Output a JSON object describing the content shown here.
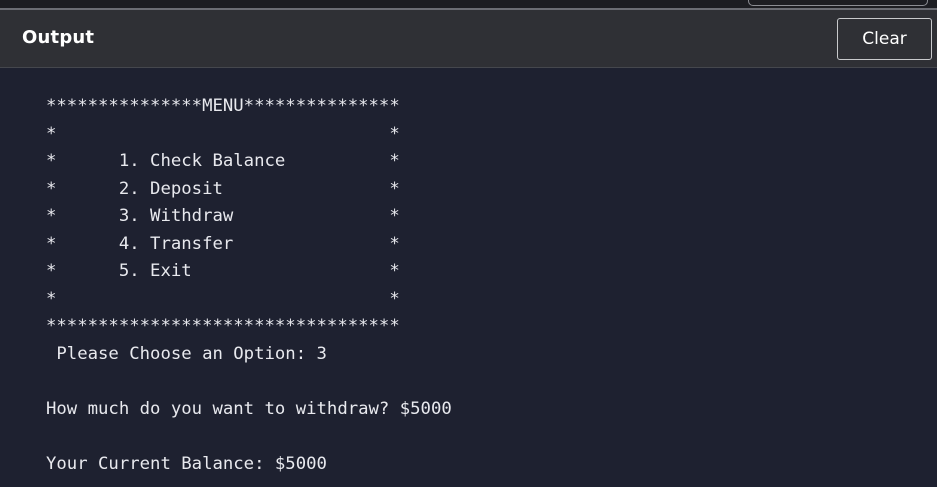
{
  "header": {
    "title": "Output",
    "clear_label": "Clear"
  },
  "console": {
    "lines": [
      "***************MENU***************",
      "*                                *",
      "*      1. Check Balance          *",
      "*      2. Deposit                *",
      "*      3. Withdraw               *",
      "*      4. Transfer               *",
      "*      5. Exit                   *",
      "*                                *",
      "**********************************",
      " Please Choose an Option: 3",
      "",
      "How much do you want to withdraw? $5000",
      "",
      "Your Current Balance: $5000"
    ]
  },
  "colors": {
    "background": "#1e2130",
    "header_background": "#2f3035",
    "text": "#e8e9ee"
  }
}
